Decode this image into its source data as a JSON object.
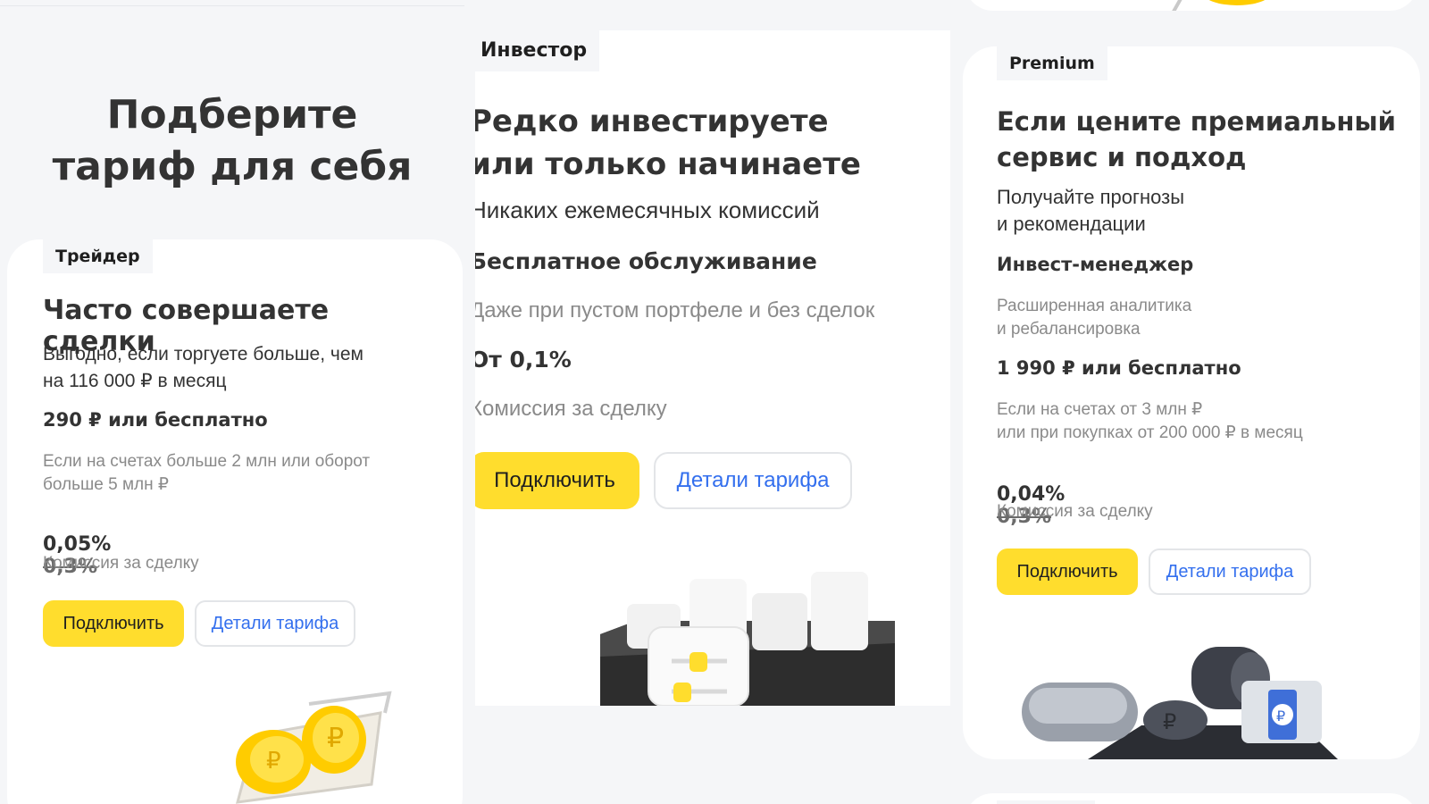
{
  "page": {
    "headline": "Подберите тариф\nдля себя"
  },
  "colors": {
    "accent_yellow": "#ffdd2d",
    "link_blue": "#336fee",
    "text_dark": "#333333",
    "text_muted": "#8a8a8a",
    "background": "#f5f6f8"
  },
  "cards": {
    "trader": {
      "tag": "Трейдер",
      "title": "Часто совершаете сделки",
      "subtitle": "Выгодно, если торгуете больше, чем\nна 116 000 ₽ в месяц",
      "price": "290 ₽ или бесплатно",
      "price_note": "Если на счетах больше 2 млн или оборот\nбольше 5 млн ₽",
      "commission": "0,05%",
      "commission_old": "0,3%",
      "commission_label": "Комиссия за сделку",
      "connect_label": "Подключить",
      "details_label": "Детали тарифа",
      "illustration_icon": "coin-cart-icon"
    },
    "investor": {
      "tag": "Инвестор",
      "title": "Редко инвестируете\nили только начинаете",
      "subtitle": "Никаких ежемесячных комиссий",
      "feature": "Бесплатное обслуживание",
      "feature_note": "Даже при пустом портфеле и без сделок",
      "commission": "От 0,1%",
      "commission_label": "Комиссия за сделку",
      "connect_label": "Подключить",
      "details_label": "Детали тарифа",
      "illustration_icon": "chart-blocks-icon"
    },
    "premium": {
      "tag": "Premium",
      "title": "Если цените премиальный\nсервис и подход",
      "subtitle": "Получайте прогнозы\nи рекомендации",
      "feature": "Инвест-менеджер",
      "feature_note": "Расширенная аналитика\nи ребалансировка",
      "price": "1 990 ₽ или бесплатно",
      "price_note": "Если на счетах от 3 млн ₽\nили при покупках от 200 000 ₽ в месяц",
      "commission": "0,04%",
      "commission_old": "0,3%",
      "commission_label": "Комиссия за сделку",
      "connect_label": "Подключить",
      "details_label": "Детали тарифа",
      "illustration_icon": "metal-shapes-icon"
    }
  }
}
